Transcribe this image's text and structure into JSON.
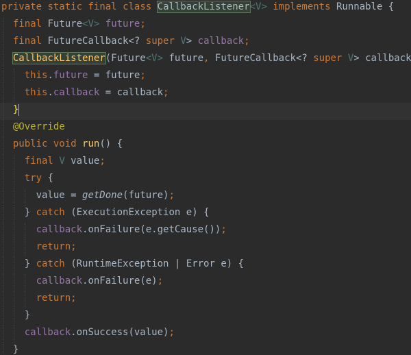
{
  "code": {
    "kw_private": "private",
    "kw_static": "static",
    "kw_final": "final",
    "kw_class": "class",
    "class_name": "CallbackListener",
    "type_param": "<V>",
    "kw_implements": "implements",
    "iface": "Runnable",
    "brace_open": "{",
    "brace_close": "}",
    "type_future": "Future",
    "field_future": "future",
    "type_futurecallback": "FutureCallback",
    "wildcard_open": "<?",
    "kw_super": "super",
    "tparam_v": "V",
    "gt": ">",
    "lt": "<",
    "field_callback": "callback",
    "semi": ";",
    "ctor_params_a": "(Future",
    "param_future": " future",
    "comma": ",",
    "param_callback": " callback)",
    "kw_this": "this",
    "dot": ".",
    "assign_future": " = future",
    "assign_callback": " = callback",
    "annotation": "@Override",
    "kw_public": "public",
    "kw_void": "void",
    "method_run": "run",
    "parens": "()",
    "local_value": " value",
    "kw_try": "try",
    "value_assign": "value = ",
    "fn_getdone": "getDone",
    "getdone_args": "(future)",
    "kw_catch": "catch",
    "catch1_args": "(ExecutionException e)",
    "on_failure": "onFailure",
    "failure1_args": "(e.getCause())",
    "kw_return": "return",
    "catch2_a": "(RuntimeException ",
    "pipe": "|",
    "catch2_b": " Error e)",
    "failure2_args": "(e)",
    "on_success": "onSuccess",
    "success_args": "(value)"
  }
}
